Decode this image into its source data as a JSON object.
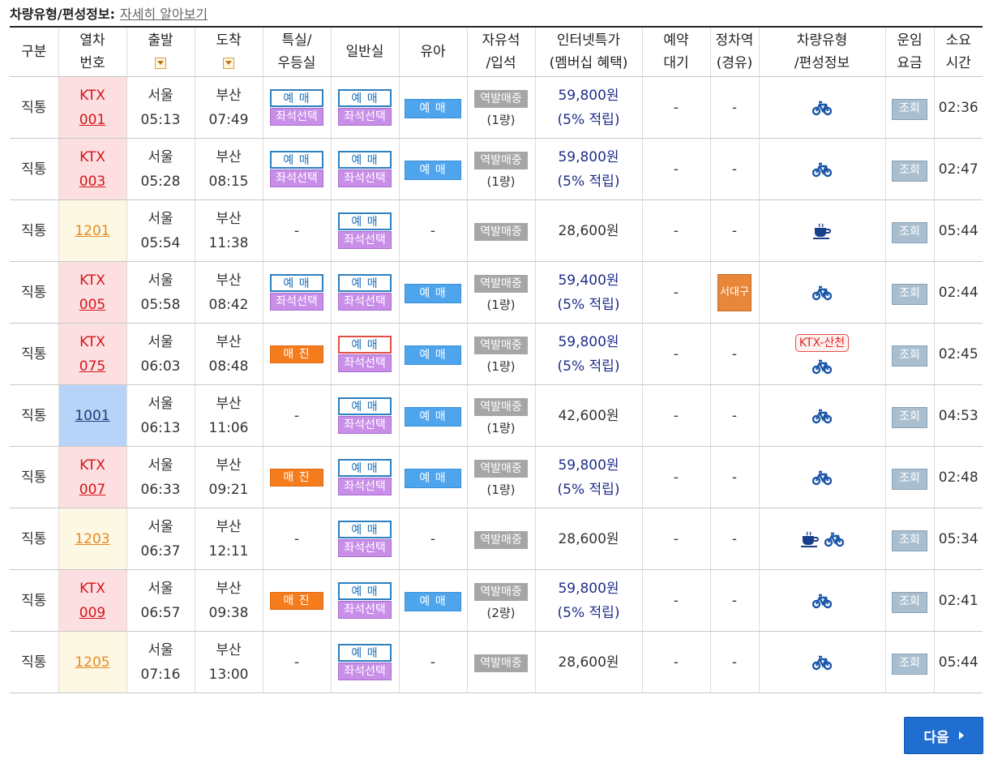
{
  "header": {
    "label": "차량유형/편성정보:",
    "link": "자세히 알아보기"
  },
  "columns": {
    "type": "구분",
    "train_no_1": "열차",
    "train_no_2": "번호",
    "dep": "출발",
    "arr": "도착",
    "special_1": "특실/",
    "special_2": "우등실",
    "general": "일반실",
    "baby": "유아",
    "free_1": "자유석",
    "free_2": "/입석",
    "price_1": "인터넷특가",
    "price_2": "(멤버십 혜택)",
    "wait_1": "예약",
    "wait_2": "대기",
    "stop_1": "정차역",
    "stop_2": "(경유)",
    "car_1": "차량유형",
    "car_2": "/편성정보",
    "fare_1": "운임",
    "fare_2": "요금",
    "dur_1": "소요",
    "dur_2": "시간"
  },
  "labels": {
    "reserve": "예 매",
    "seat": "좌석선택",
    "soldout": "매 진",
    "station_sale": "역발매중",
    "fare": "조회",
    "dash": "-",
    "next": "다음"
  },
  "rows": [
    {
      "type": "직통",
      "kind": "ktx",
      "line1": "KTX",
      "line2": "001",
      "dep_st": "서울",
      "dep_t": "05:13",
      "arr_st": "부산",
      "arr_t": "07:49",
      "special": "reserve",
      "general": "reserve",
      "baby": true,
      "cars": "(1량)",
      "price": "59,800원",
      "benefit": "(5% 적립)",
      "wait": "-",
      "stop": "-",
      "car_ktx": false,
      "car_icons": [
        "bike"
      ],
      "dur": "02:36"
    },
    {
      "type": "직통",
      "kind": "ktx",
      "line1": "KTX",
      "line2": "003",
      "dep_st": "서울",
      "dep_t": "05:28",
      "arr_st": "부산",
      "arr_t": "08:15",
      "special": "reserve",
      "general": "reserve",
      "baby": true,
      "cars": "(1량)",
      "price": "59,800원",
      "benefit": "(5% 적립)",
      "wait": "-",
      "stop": "-",
      "car_ktx": false,
      "car_icons": [
        "bike"
      ],
      "dur": "02:47"
    },
    {
      "type": "직통",
      "kind": "mug",
      "line1": "1201",
      "line2": "",
      "dep_st": "서울",
      "dep_t": "05:54",
      "arr_st": "부산",
      "arr_t": "11:38",
      "special": "dash",
      "general": "reserve",
      "baby": false,
      "cars": "",
      "price": "28,600원",
      "benefit": "",
      "wait": "-",
      "stop": "-",
      "car_ktx": false,
      "car_icons": [
        "cafe"
      ],
      "dur": "05:44"
    },
    {
      "type": "직통",
      "kind": "ktx",
      "line1": "KTX",
      "line2": "005",
      "dep_st": "서울",
      "dep_t": "05:58",
      "arr_st": "부산",
      "arr_t": "08:42",
      "special": "reserve",
      "general": "reserve",
      "baby": true,
      "cars": "(1량)",
      "price": "59,400원",
      "benefit": "(5% 적립)",
      "wait": "-",
      "stop": "서대구",
      "car_ktx": false,
      "car_icons": [
        "bike"
      ],
      "dur": "02:44"
    },
    {
      "type": "직통",
      "kind": "ktx",
      "line1": "KTX",
      "line2": "075",
      "dep_st": "서울",
      "dep_t": "06:03",
      "arr_st": "부산",
      "arr_t": "08:48",
      "special": "soldout",
      "general": "reserve-red",
      "baby": true,
      "cars": "(1량)",
      "price": "59,800원",
      "benefit": "(5% 적립)",
      "wait": "-",
      "stop": "-",
      "car_ktx": true,
      "car_ktx_label": "KTX-산천",
      "car_icons": [
        "bike"
      ],
      "dur": "02:45"
    },
    {
      "type": "직통",
      "kind": "itx",
      "line1": "1001",
      "line2": "",
      "dep_st": "서울",
      "dep_t": "06:13",
      "arr_st": "부산",
      "arr_t": "11:06",
      "special": "dash",
      "general": "reserve",
      "baby": true,
      "cars": "(1량)",
      "price": "42,600원",
      "benefit": "",
      "wait": "-",
      "stop": "-",
      "car_ktx": false,
      "car_icons": [
        "bike"
      ],
      "dur": "04:53"
    },
    {
      "type": "직통",
      "kind": "ktx",
      "line1": "KTX",
      "line2": "007",
      "dep_st": "서울",
      "dep_t": "06:33",
      "arr_st": "부산",
      "arr_t": "09:21",
      "special": "soldout",
      "general": "reserve",
      "baby": true,
      "cars": "(1량)",
      "price": "59,800원",
      "benefit": "(5% 적립)",
      "wait": "-",
      "stop": "-",
      "car_ktx": false,
      "car_icons": [
        "bike"
      ],
      "dur": "02:48"
    },
    {
      "type": "직통",
      "kind": "mug",
      "line1": "1203",
      "line2": "",
      "dep_st": "서울",
      "dep_t": "06:37",
      "arr_st": "부산",
      "arr_t": "12:11",
      "special": "dash",
      "general": "reserve",
      "baby": false,
      "cars": "",
      "price": "28,600원",
      "benefit": "",
      "wait": "-",
      "stop": "-",
      "car_ktx": false,
      "car_icons": [
        "cafe",
        "bike"
      ],
      "dur": "05:34"
    },
    {
      "type": "직통",
      "kind": "ktx",
      "line1": "KTX",
      "line2": "009",
      "dep_st": "서울",
      "dep_t": "06:57",
      "arr_st": "부산",
      "arr_t": "09:38",
      "special": "soldout",
      "general": "reserve",
      "baby": true,
      "cars": "(2량)",
      "price": "59,800원",
      "benefit": "(5% 적립)",
      "wait": "-",
      "stop": "-",
      "car_ktx": false,
      "car_icons": [
        "bike"
      ],
      "dur": "02:41"
    },
    {
      "type": "직통",
      "kind": "mug",
      "line1": "1205",
      "line2": "",
      "dep_st": "서울",
      "dep_t": "07:16",
      "arr_st": "부산",
      "arr_t": "13:00",
      "special": "dash",
      "general": "reserve",
      "baby": false,
      "cars": "",
      "price": "28,600원",
      "benefit": "",
      "wait": "-",
      "stop": "-",
      "car_ktx": false,
      "car_icons": [
        "bike"
      ],
      "dur": "05:44"
    }
  ]
}
